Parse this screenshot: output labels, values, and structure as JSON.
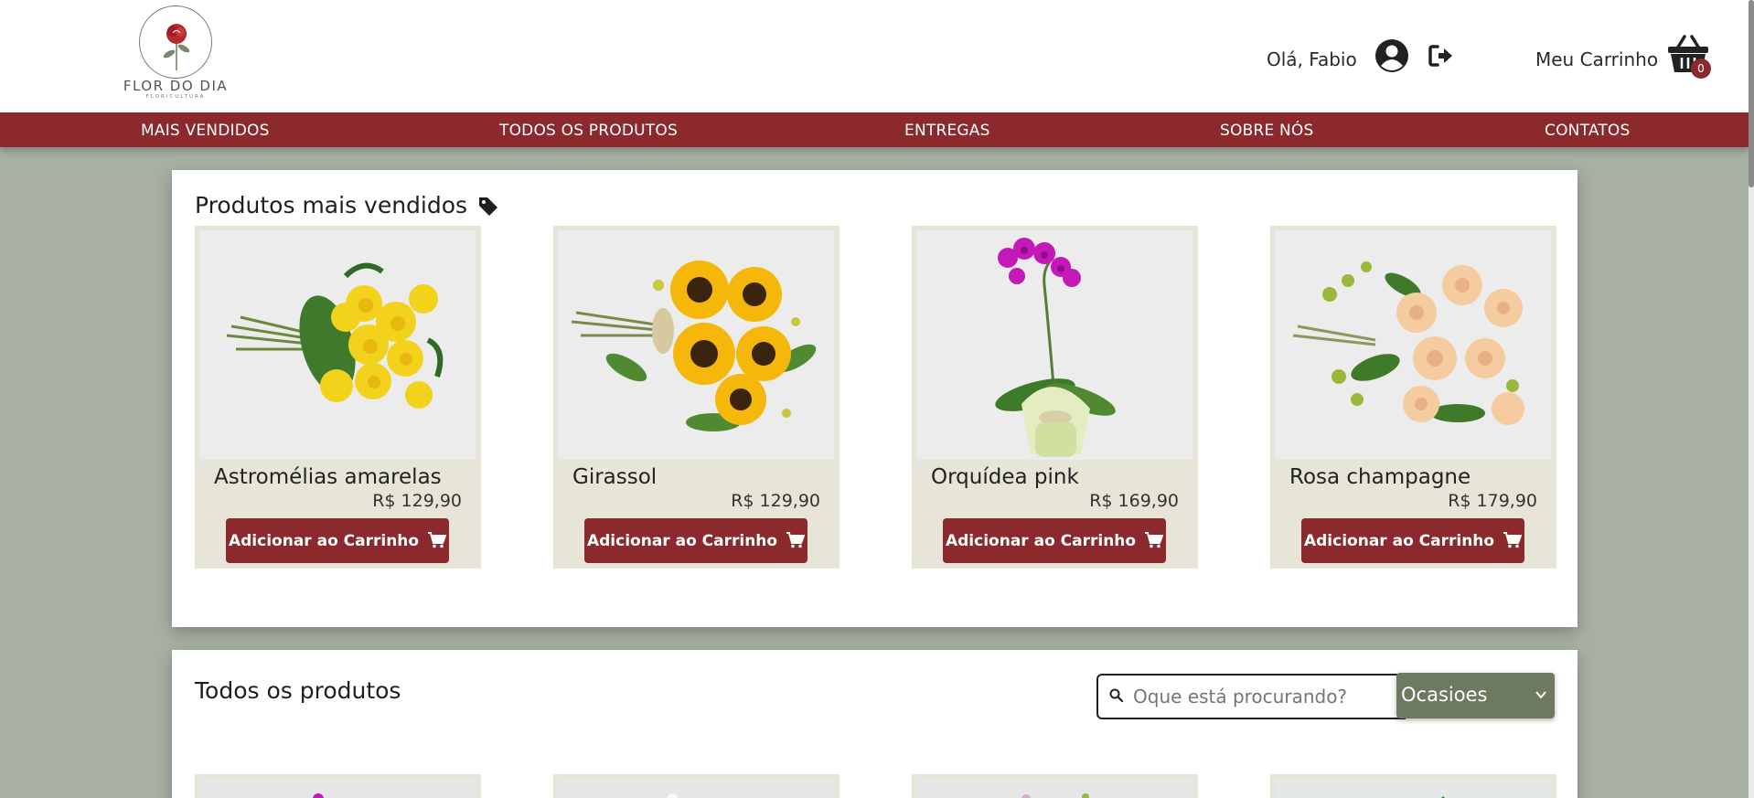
{
  "header": {
    "logo_text": "FLOR DO DIA",
    "logo_sub": "FLORICULTURA",
    "greeting": "Olá, Fabio",
    "cart_label": "Meu Carrinho",
    "cart_count": "0",
    "icons": [
      "user-circle-icon",
      "logout-icon",
      "basket-icon"
    ]
  },
  "nav": {
    "items": [
      {
        "label": "MAIS VENDIDOS"
      },
      {
        "label": "TODOS OS PRODUTOS"
      },
      {
        "label": "ENTREGAS"
      },
      {
        "label": "SOBRE NÓS"
      },
      {
        "label": "CONTATOS"
      }
    ]
  },
  "best_sellers": {
    "title": "Produtos mais vendidos",
    "icon": "tag-icon",
    "products": [
      {
        "name": "Astromélias amarelas",
        "price": "R$ 129,90",
        "button": "Adicionar ao Carrinho"
      },
      {
        "name": "Girassol",
        "price": "R$ 129,90",
        "button": "Adicionar ao Carrinho"
      },
      {
        "name": "Orquídea pink",
        "price": "R$ 169,90",
        "button": "Adicionar ao Carrinho"
      },
      {
        "name": "Rosa champagne",
        "price": "R$ 179,90",
        "button": "Adicionar ao Carrinho"
      }
    ]
  },
  "all_products": {
    "title": "Todos os produtos",
    "search_placeholder": "Oque está procurando?",
    "filter_selected": "Ocasioes"
  },
  "colors": {
    "brand": "#8b292c",
    "background": "#a8b0a4",
    "card": "#e6e5d8",
    "filter": "#6e7a5f"
  }
}
